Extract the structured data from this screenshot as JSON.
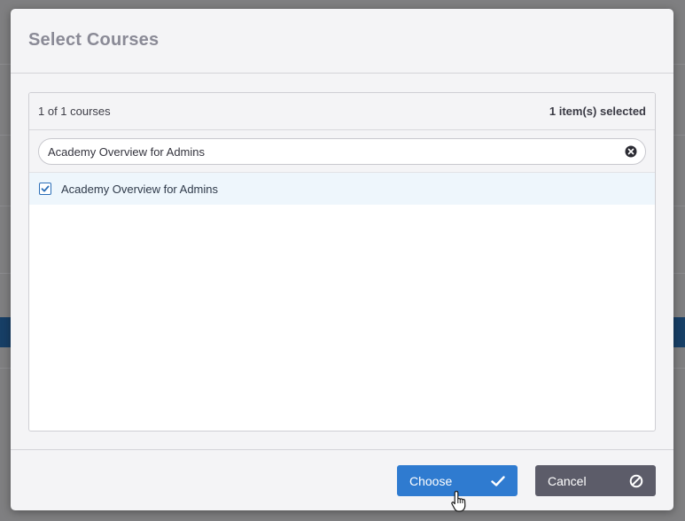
{
  "dialog": {
    "title": "Select Courses"
  },
  "list": {
    "count_text": "1 of 1 courses",
    "selected_text": "1 item(s) selected",
    "search": {
      "value": "Academy Overview for Admins",
      "placeholder": ""
    },
    "items": [
      {
        "label": "Academy Overview for Admins",
        "checked": true
      }
    ]
  },
  "footer": {
    "choose_label": "Choose",
    "cancel_label": "Cancel"
  },
  "icons": {
    "clear": "clear-circle-icon",
    "checkbox": "checkmark-icon",
    "choose": "checkmark-icon",
    "cancel": "ban-icon",
    "cursor": "hand-pointer-cursor"
  },
  "colors": {
    "primary": "#2f7bd0",
    "secondary": "#5c5c69",
    "selected_row": "#eef6fc",
    "title": "#8a8a96"
  }
}
